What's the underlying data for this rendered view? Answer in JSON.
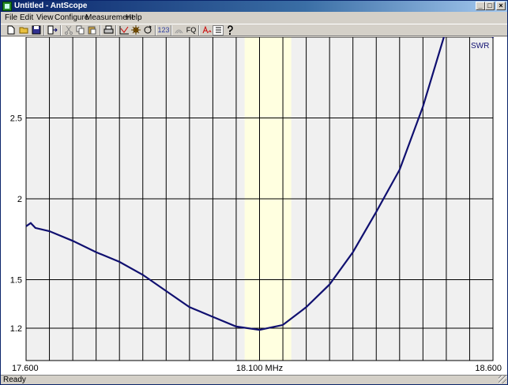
{
  "window": {
    "title": "Untitled - AntScope",
    "minimize_label": "_",
    "maximize_label": "□",
    "close_label": "×"
  },
  "menu": [
    "File",
    "Edit",
    "View",
    "Configure",
    "Measurement",
    "Help"
  ],
  "toolbar": {
    "buttons": [
      "new-file-icon",
      "open-file-icon",
      "save-icon",
      "export-icon",
      "cut-icon",
      "copy-icon",
      "paste-icon",
      "print-icon",
      "graph-icon",
      "settings-icon",
      "refresh-icon",
      "numbers-icon",
      "signal-icon",
      "fq-icon",
      "bookmark-icon",
      "list-icon",
      "help-icon"
    ],
    "numbers_label": "123",
    "fq_label": "FQ"
  },
  "status": {
    "text": "Ready"
  },
  "colors": {
    "curve": "#101070",
    "band": "#ffffe0",
    "plot_bg": "#f0f0f0",
    "grid": "#000000"
  },
  "chart_data": {
    "type": "line",
    "series": [
      {
        "name": "SWR",
        "x": [
          17.6,
          17.61,
          17.62,
          17.65,
          17.7,
          17.75,
          17.8,
          17.85,
          17.9,
          17.95,
          18.0,
          18.05,
          18.1,
          18.15,
          18.2,
          18.25,
          18.3,
          18.35,
          18.4,
          18.45,
          18.5,
          18.55
        ],
        "y": [
          1.83,
          1.85,
          1.82,
          1.8,
          1.74,
          1.67,
          1.61,
          1.53,
          1.43,
          1.33,
          1.27,
          1.21,
          1.19,
          1.22,
          1.33,
          1.47,
          1.67,
          1.92,
          2.18,
          2.57,
          3.05,
          3.48
        ]
      }
    ],
    "x_labels": {
      "left": "17.600",
      "center": "18.100 MHz",
      "right": "18.600"
    },
    "y_ticks": [
      1.2,
      1.5,
      2,
      2.5
    ],
    "y_tick_labels": [
      "1.2",
      "1.5",
      "2",
      "2.5"
    ],
    "xlim": [
      17.6,
      18.6
    ],
    "ylim": [
      1.0,
      3.0
    ],
    "band": [
      18.068,
      18.168
    ],
    "grid": true,
    "legend": "top-right"
  }
}
